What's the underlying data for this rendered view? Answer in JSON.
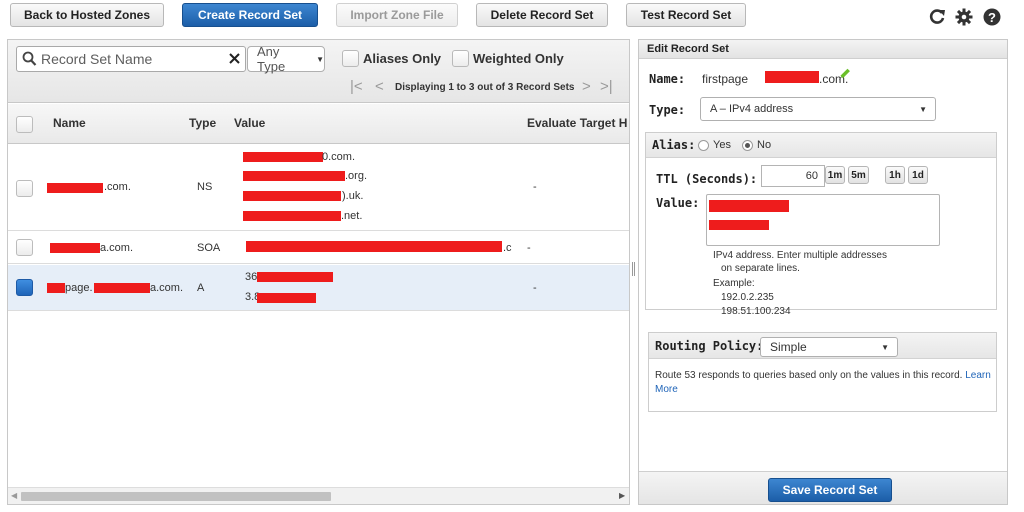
{
  "toolbar": {
    "back": "Back to Hosted Zones",
    "create": "Create Record Set",
    "import": "Import Zone File",
    "delete": "Delete Record Set",
    "test": "Test Record Set",
    "icons": [
      "refresh-icon",
      "gear-icon",
      "help-icon"
    ]
  },
  "filters": {
    "search_placeholder": "Record Set Name",
    "type_select": "Any Type",
    "aliases_only": "Aliases Only",
    "weighted_only": "Weighted Only",
    "pager_text": "Displaying 1 to 3 out of 3 Record Sets"
  },
  "table": {
    "columns": [
      "Name",
      "Type",
      "Value",
      "Evaluate Target H"
    ],
    "rows": [
      {
        "name_suffix": ".com.",
        "type": "NS",
        "values": [
          "0.com.",
          ".org.",
          ").uk.",
          ".net."
        ],
        "evaluate": "-",
        "selected": false
      },
      {
        "name_suffix": "a.com.",
        "type": "SOA",
        "values": [
          ".c"
        ],
        "evaluate": "-",
        "selected": false
      },
      {
        "name_prefix": "page.",
        "name_suffix": "a.com.",
        "type": "A",
        "values": [
          "36",
          "3.8"
        ],
        "evaluate": "-",
        "selected": true
      }
    ]
  },
  "editor": {
    "title": "Edit Record Set",
    "name_label": "Name:",
    "name_value": "firstpage",
    "name_suffix": ".com.",
    "type_label": "Type:",
    "type_value": "A – IPv4 address",
    "alias_label": "Alias:",
    "alias_yes": "Yes",
    "alias_no": "No",
    "alias_selected": "No",
    "ttl_label": "TTL (Seconds):",
    "ttl_value": "60",
    "ttl_buttons": [
      "1m",
      "5m",
      "1h",
      "1d"
    ],
    "value_label": "Value:",
    "help_lines": [
      "IPv4 address. Enter multiple addresses",
      "on separate lines.",
      "Example:",
      "192.0.2.235",
      "198.51.100.234"
    ],
    "routing_label": "Routing Policy:",
    "routing_value": "Simple",
    "routing_text": "Route 53 responds to queries based only on the values in this record.",
    "learn": "Learn",
    "more": "More",
    "save": "Save Record Set"
  },
  "colors": {
    "primary": "#1c5ea8",
    "redaction": "#ee1c1c",
    "selected_row": "#e6eef8"
  }
}
